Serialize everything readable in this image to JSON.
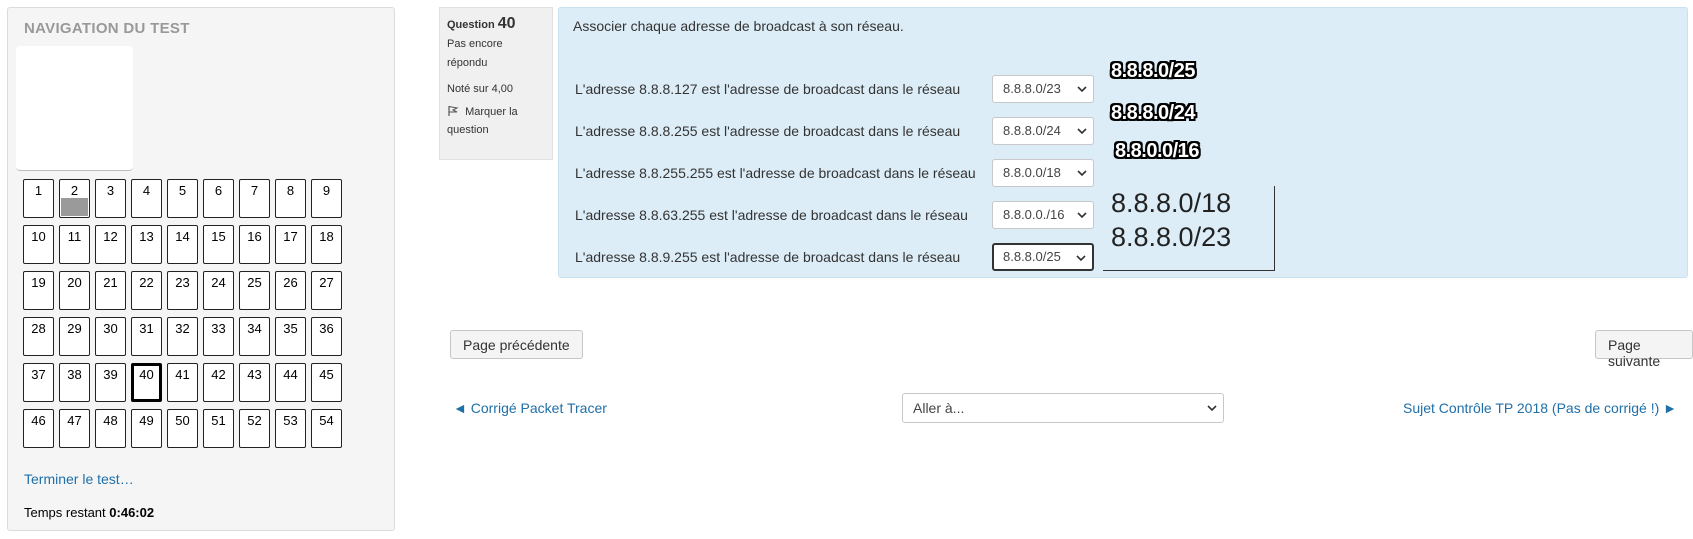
{
  "navigation": {
    "title": "NAVIGATION DU TEST",
    "questions": [
      "1",
      "2",
      "3",
      "4",
      "5",
      "6",
      "7",
      "8",
      "9",
      "10",
      "11",
      "12",
      "13",
      "14",
      "15",
      "16",
      "17",
      "18",
      "19",
      "20",
      "21",
      "22",
      "23",
      "24",
      "25",
      "26",
      "27",
      "28",
      "29",
      "30",
      "31",
      "32",
      "33",
      "34",
      "35",
      "36",
      "37",
      "38",
      "39",
      "40",
      "41",
      "42",
      "43",
      "44",
      "45",
      "46",
      "47",
      "48",
      "49",
      "50",
      "51",
      "52",
      "53",
      "54"
    ],
    "answered_questions": [
      "2"
    ],
    "current_question": "40",
    "finish_link": "Terminer le test…",
    "time_label": "Temps restant",
    "time_value": "0:46:02"
  },
  "question_info": {
    "label": "Question",
    "number": "40",
    "status": "Pas encore répondu",
    "grade": "Noté sur 4,00",
    "flag_label": "Marquer la question"
  },
  "question": {
    "text": "Associer chaque adresse de broadcast à son réseau.",
    "rows": [
      {
        "label": "L'adresse 8.8.8.127 est l'adresse de broadcast dans le réseau",
        "selected": "8.8.8.0/23"
      },
      {
        "label": "L'adresse 8.8.8.255 est l'adresse de broadcast dans le réseau",
        "selected": "8.8.8.0/24"
      },
      {
        "label": "L'adresse 8.8.255.255 est l'adresse de broadcast dans le réseau",
        "selected": "8.8.0.0/18"
      },
      {
        "label": "L'adresse 8.8.63.255 est l'adresse de broadcast dans le réseau",
        "selected": "8.8.0.0./16"
      },
      {
        "label": "L'adresse 8.8.9.255 est l'adresse de broadcast dans le réseau",
        "selected": "8.8.8.0/25"
      }
    ],
    "annotations": [
      "8.8.8.0/25",
      "8.8.8.0/24",
      "8.8.0.0/16",
      "8.8.8.0/18",
      "8.8.8.0/23"
    ]
  },
  "buttons": {
    "previous_page": "Page précédente",
    "next_page": "Page suivante"
  },
  "footer_nav": {
    "prev_link": "◄ Corrigé Packet Tracer",
    "jump_placeholder": "Aller à...",
    "next_link": "Sujet Contrôle TP 2018 (Pas de corrigé !) ►"
  },
  "colors": {
    "question_bg": "#dcedf7",
    "link": "#1f6fa8",
    "answered_fill": "#9a9a9a"
  },
  "icons": {
    "flag": "flag-icon",
    "dropdown": "chevron-down-icon"
  }
}
